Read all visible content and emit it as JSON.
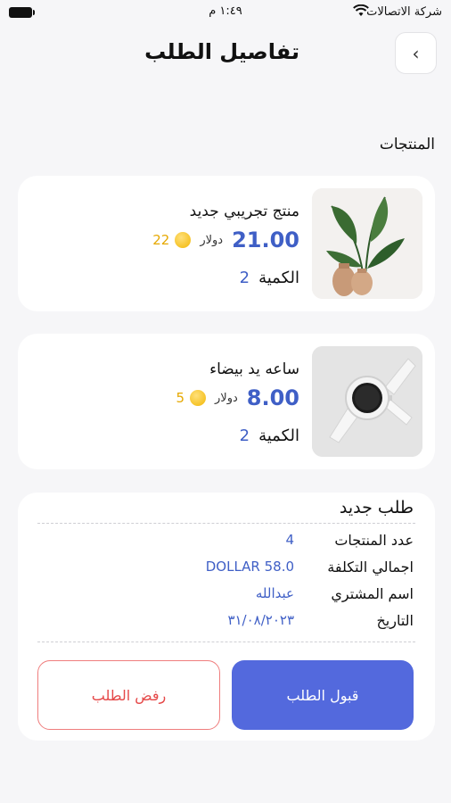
{
  "status": {
    "carrier": "شركة الاتصالات",
    "time": "١:٤٩ م"
  },
  "header": {
    "title": "تفاصيل الطلب"
  },
  "products_label": "المنتجات",
  "products": [
    {
      "name": "منتج تجريبي جديد",
      "price": "21.00",
      "currency": "دولار",
      "points": "22",
      "qty_label": "الكمية",
      "qty": "2",
      "image": "plant-icon"
    },
    {
      "name": "ساعه يد بيضاء",
      "price": "8.00",
      "currency": "دولار",
      "points": "5",
      "qty_label": "الكمية",
      "qty": "2",
      "image": "watch-icon"
    }
  ],
  "order": {
    "title": "طلب جديد",
    "rows": [
      {
        "label": "عدد المنتجات",
        "value": "4"
      },
      {
        "label": "اجمالي التكلفة",
        "value": "DOLLAR 58.0"
      },
      {
        "label": "اسم المشتري",
        "value": "عبدالله"
      },
      {
        "label": "التاريخ",
        "value": "٣١/٠٨/٢٠٢٣"
      }
    ]
  },
  "actions": {
    "accept": "قبول الطلب",
    "reject": "رفض الطلب"
  },
  "colors": {
    "accent": "#5369dd",
    "price": "#3f5fc6",
    "danger": "#e54848",
    "points": "#e6a800"
  }
}
